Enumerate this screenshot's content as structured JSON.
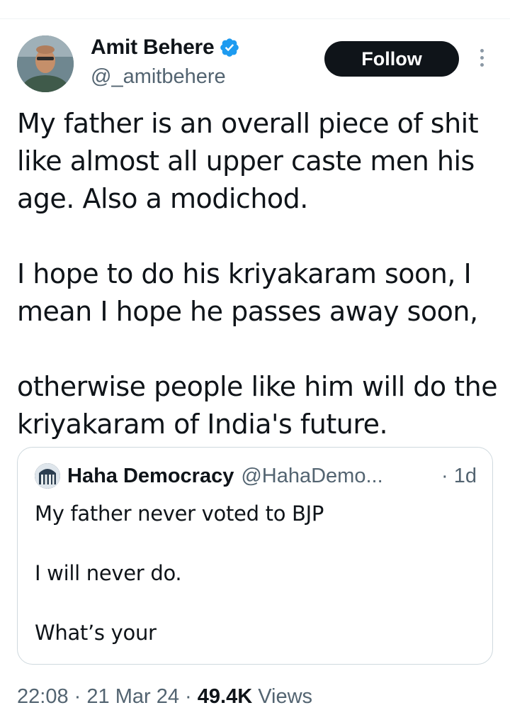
{
  "author": {
    "name": "Amit Behere",
    "handle": "@_amitbehere",
    "avatar_icon": "person-photo-avatar",
    "verified_icon": "verified-badge-icon",
    "verified_color": "#1d9bf0"
  },
  "follow_button": {
    "label": "Follow"
  },
  "more_icon": "vertical-ellipsis-icon",
  "tweet": {
    "text": "My father is an overall piece of shit\nlike almost all upper caste men his\nage. Also a modichod.\n\nI hope to do his kriyakaram soon, I\nmean I hope he passes away soon,\n\notherwise people like him will do the\nkriyakaram of India's future."
  },
  "quoted_tweet": {
    "name": "Haha Democracy",
    "handle": "@HahaDemo...",
    "time": "· 1d",
    "text": "My father never voted to BJP\n\nI will never do.\n\nWhat’s your"
  },
  "meta": {
    "time": "22:08",
    "separator": "·",
    "date": "21 Mar 24",
    "views_count": "49.4K",
    "views_label": "Views"
  },
  "colors": {
    "text_primary": "#0f1419",
    "text_secondary": "#536471",
    "border": "#cfd9de",
    "accent": "#1d9bf0"
  }
}
